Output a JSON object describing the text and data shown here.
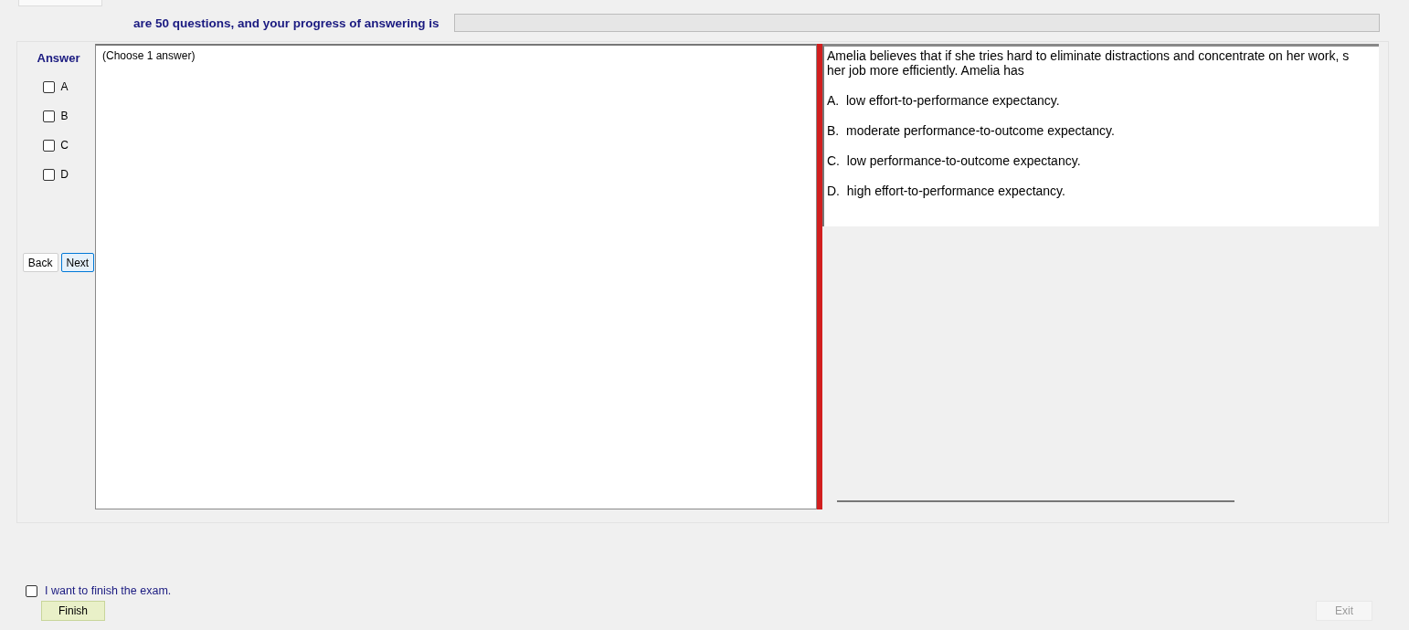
{
  "header": {
    "text": "are 50 questions, and your progress of answering is",
    "progress": {
      "level": 0
    }
  },
  "answer_panel": {
    "title": "Answer",
    "options": [
      {
        "label": "A",
        "checked": false
      },
      {
        "label": "B",
        "checked": false
      },
      {
        "label": "C",
        "checked": false
      },
      {
        "label": "D",
        "checked": false
      }
    ],
    "buttons": [
      {
        "label": "Back",
        "selected": false
      },
      {
        "label": "Next",
        "selected": true
      }
    ]
  },
  "answer_area": {
    "hint": "(Choose 1 answer)"
  },
  "question": {
    "lines": [
      "Amelia believes that if she tries hard to eliminate distractions and concentrate on her work, s",
      "her job more efficiently. Amelia has"
    ],
    "choices": [
      "A.  low effort-to-performance expectancy.",
      "B.  moderate performance-to-outcome expectancy.",
      "C.  low performance-to-outcome expectancy.",
      "D.  high effort-to-performance expectancy."
    ]
  },
  "finish": {
    "label": "I want to finish the exam.",
    "checked": false,
    "button": "Finish"
  },
  "exit_button": {
    "label": "Exit",
    "disabled": true
  }
}
